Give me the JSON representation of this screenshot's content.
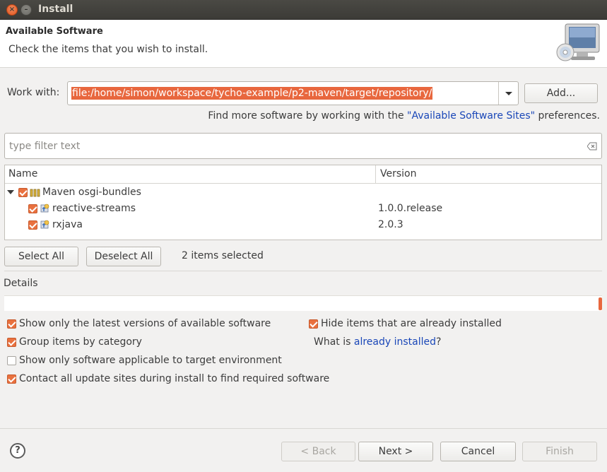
{
  "window": {
    "title": "Install"
  },
  "header": {
    "title": "Available Software",
    "description": "Check the items that you wish to install."
  },
  "work_with": {
    "label": "Work with:",
    "value": "file:/home/simon/workspace/tycho-example/p2-maven/target/repository/",
    "add_label": "Add..."
  },
  "find_more": {
    "prefix": "Find more software by working with the ",
    "link": "\"Available Software Sites\"",
    "suffix": " preferences."
  },
  "filter": {
    "placeholder": "type filter text"
  },
  "tree": {
    "columns": [
      "Name",
      "Version"
    ],
    "category": {
      "name": "Maven osgi-bundles"
    },
    "items": [
      {
        "name": "reactive-streams",
        "version": "1.0.0.release"
      },
      {
        "name": "rxjava",
        "version": "2.0.3"
      }
    ]
  },
  "selection": {
    "select_all": "Select All",
    "deselect_all": "Deselect All",
    "status": "2 items selected"
  },
  "details": {
    "label": "Details"
  },
  "options": {
    "latest_versions": "Show only the latest versions of available software",
    "hide_installed": "Hide items that are already installed",
    "group_by_category": "Group items by category",
    "what_is_prefix": "What is ",
    "what_is_link": "already installed",
    "what_is_suffix": "?",
    "target_env": "Show only software applicable to target environment",
    "contact_sites": "Contact all update sites during install to find required software"
  },
  "footer": {
    "back": "< Back",
    "next": "Next >",
    "cancel": "Cancel",
    "finish": "Finish",
    "help": "?"
  },
  "colors": {
    "accent": "#e9713f",
    "link": "#1a47b8"
  }
}
